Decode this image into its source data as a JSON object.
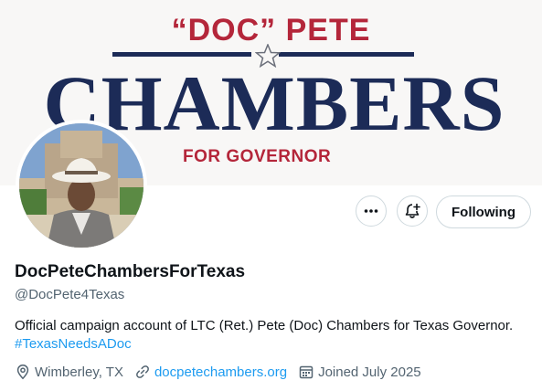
{
  "banner": {
    "top_text": "“DOC” PETE",
    "main_text": "CHAMBERS",
    "sub_text": "FOR GOVERNOR"
  },
  "actions": {
    "more_icon": "more-icon",
    "notify_icon": "bell-plus-icon",
    "follow_label": "Following"
  },
  "profile": {
    "display_name": "DocPeteChambersForTexas",
    "handle": "@DocPete4Texas",
    "bio_line1": "Official campaign account of LTC (Ret.) Pete (Doc) Chambers for Texas Governor.",
    "bio_hashtag": "#TexasNeedsADoc"
  },
  "meta": {
    "location": "Wimberley, TX",
    "website": "docpetechambers.org",
    "joined": "Joined July 2025"
  },
  "colors": {
    "link": "#1d9bf0",
    "banner_red": "#b4263a",
    "banner_navy": "#1c2b57",
    "secondary_text": "#536471"
  }
}
